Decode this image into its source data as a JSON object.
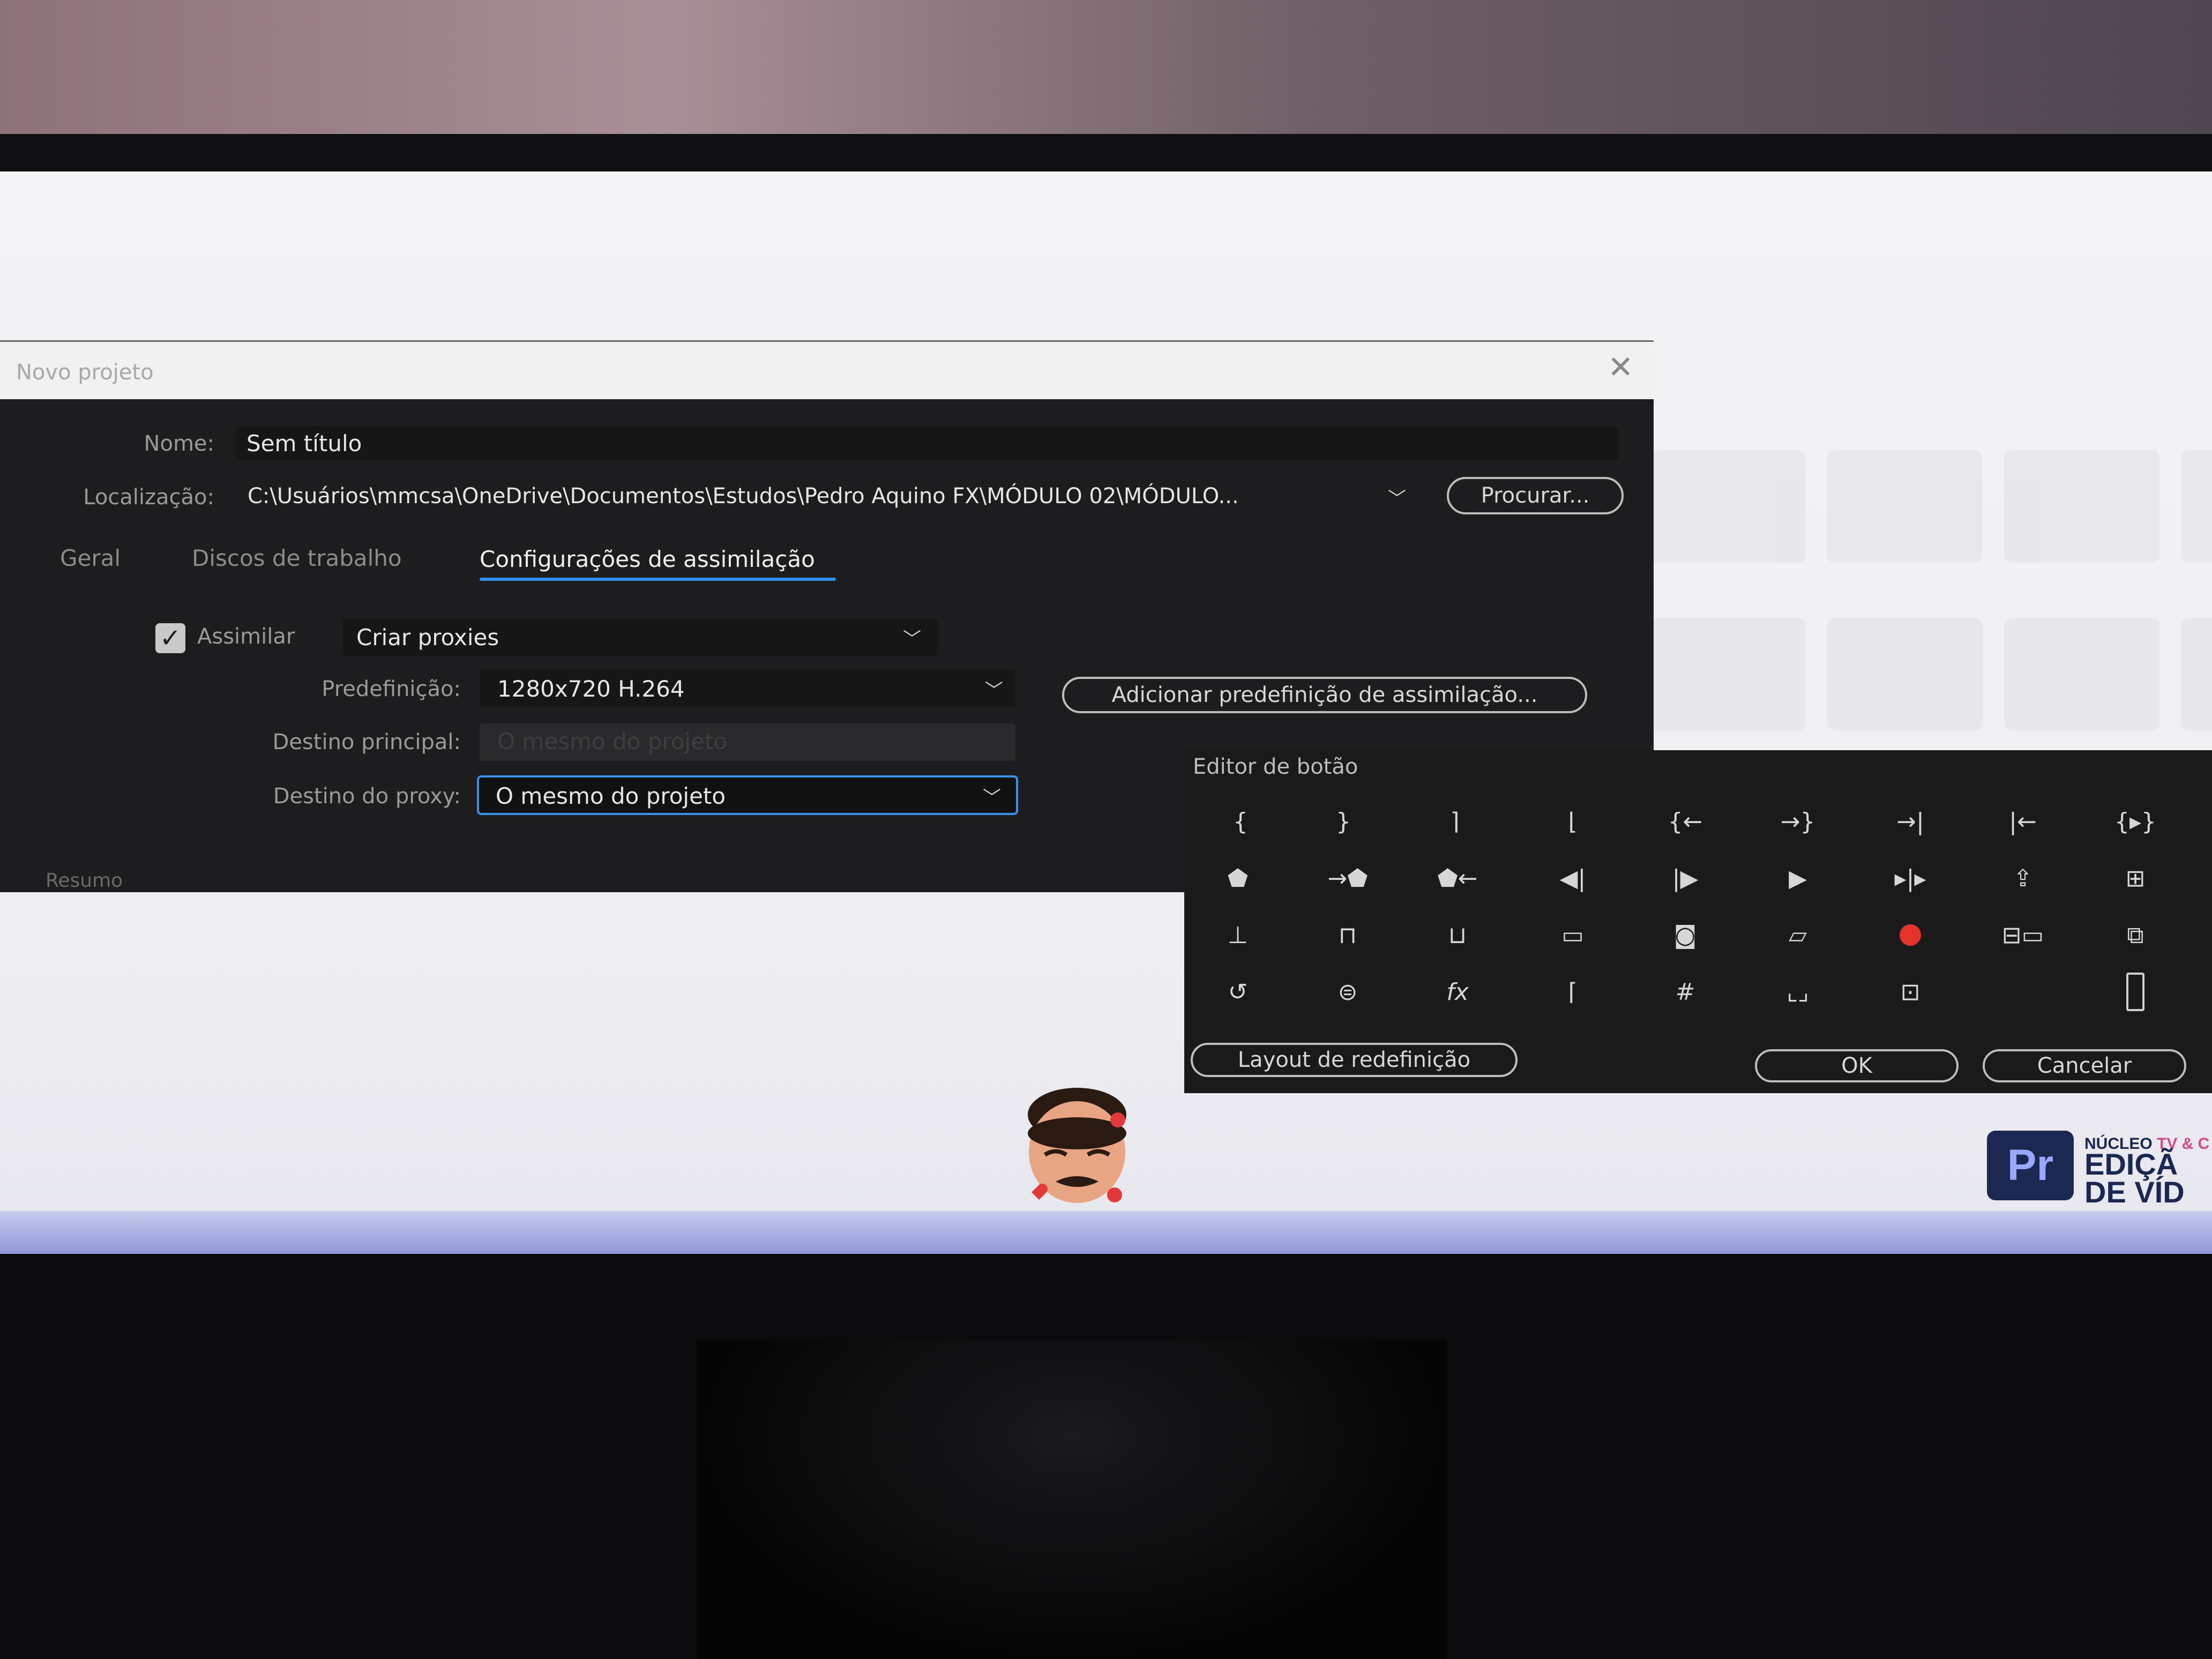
{
  "new_project": {
    "title": "Novo projeto",
    "name_label": "Nome:",
    "name_value": "Sem título",
    "location_label": "Localização:",
    "location_value": "C:\\Usuários\\mmcsa\\OneDrive\\Documentos\\Estudos\\Pedro Aquino FX\\MÓDULO 02\\MÓDULO...",
    "browse_label": "Procurar...",
    "tabs": [
      {
        "label": "Geral"
      },
      {
        "label": "Discos de trabalho"
      },
      {
        "label": "Configurações de assimilação"
      }
    ],
    "active_tab": "Configurações de assimilação",
    "ingest_checkbox_label": "Assimilar",
    "ingest_checked": true,
    "ingest_mode_value": "Criar proxies",
    "preset_label": "Predefinição:",
    "preset_value": "1280x720 H.264",
    "add_preset_label": "Adicionar predefinição de assimilação...",
    "primary_dest_label": "Destino principal:",
    "primary_dest_value": "O mesmo do projeto",
    "proxy_dest_label": "Destino do proxy:",
    "proxy_dest_value": "O mesmo do projeto",
    "summary_label": "Resumo"
  },
  "button_editor": {
    "title": "Editor de botão",
    "icons": [
      [
        "mark-in-icon",
        "mark-out-icon",
        "clear-in-icon",
        "clear-out-icon",
        "go-to-in-icon",
        "go-to-out-icon",
        "go-to-next-edit-icon",
        "go-to-previous-edit-icon",
        "play-in-to-out-icon"
      ],
      [
        "add-marker-icon",
        "go-to-next-marker-icon",
        "go-to-previous-marker-icon",
        "step-back-icon",
        "step-forward-icon",
        "play-icon",
        "play-around-icon",
        "export-frame-icon",
        "insert-icon"
      ],
      [
        "lift-icon",
        "extract-icon",
        "overwrite-icon",
        "safe-margins-icon",
        "camera-icon",
        "comparison-view-icon",
        "record-icon",
        "multi-camera-icon",
        "toggle-proxies-icon"
      ],
      [
        "loop-icon",
        "vr-video-icon",
        "fx-icon",
        "trim-icon",
        "grid-icon",
        "show-rulers-icon",
        "snap-icon",
        "",
        "empty-slot-icon"
      ]
    ],
    "reset_label": "Layout de redefinição",
    "ok_label": "OK",
    "cancel_label": "Cancelar",
    "record_color": "#e5322a"
  },
  "branding": {
    "logo_text": "Pr",
    "line1_a": "NÚCLEO",
    "line1_b": "TV & C",
    "line2": "EDIÇÃ",
    "line3": "DE VÍD"
  },
  "accent_color": "#2f8ff0"
}
